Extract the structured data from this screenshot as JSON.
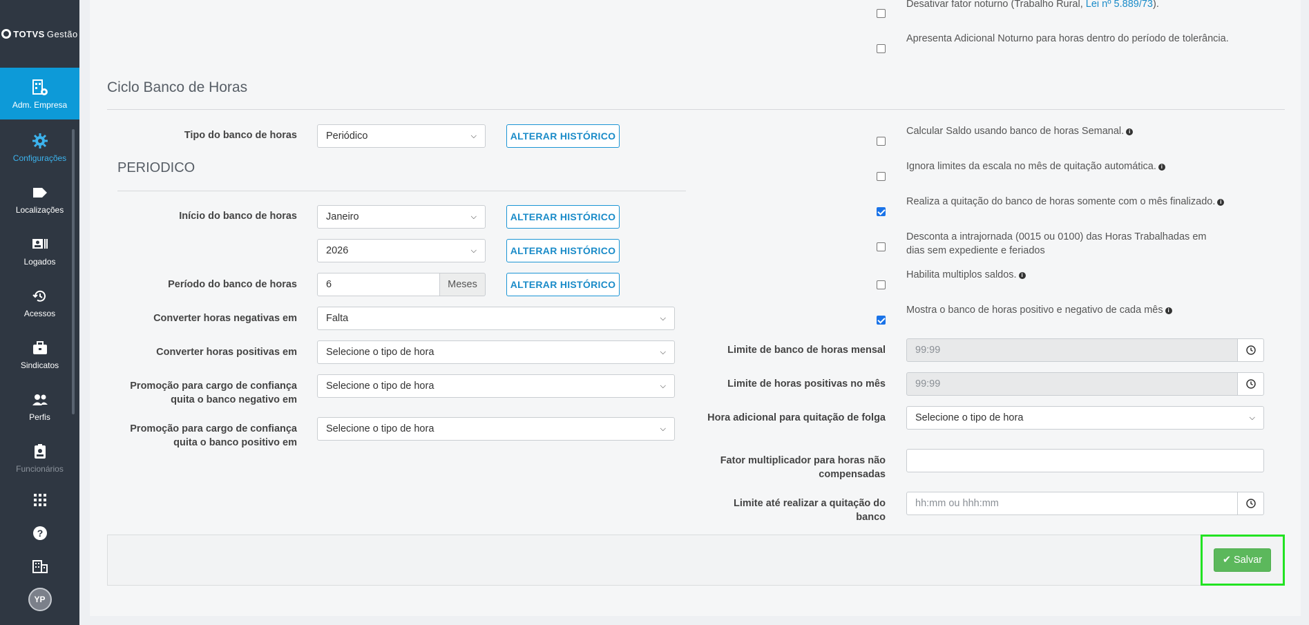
{
  "sidebar": {
    "logo_bold": "TOTVS",
    "logo_light": "Gestão",
    "items": [
      {
        "label": "Adm. Empresa",
        "icon": "building-cog-icon"
      },
      {
        "label": "Configurações",
        "icon": "gear-icon"
      },
      {
        "label": "Localizações",
        "icon": "tag-icon"
      },
      {
        "label": "Logados",
        "icon": "id-card-icon"
      },
      {
        "label": "Acessos",
        "icon": "history-icon"
      },
      {
        "label": "Sindicatos",
        "icon": "briefcase-icon"
      },
      {
        "label": "Perfis",
        "icon": "users-icon"
      },
      {
        "label": "Funcionários",
        "icon": "badge-icon"
      }
    ],
    "avatar_initials": "YP"
  },
  "top_checks": [
    {
      "text": "Desativar fator noturno (Trabalho Rural, ",
      "link": "Lei nº 5.889/73",
      "suffix": ").",
      "checked": false
    },
    {
      "text": "Apresenta Adicional Noturno para horas dentro do período de tolerância.",
      "checked": false
    }
  ],
  "ciclo": {
    "title": "Ciclo Banco de Horas",
    "tipo_label": "Tipo do banco de horas",
    "tipo_value": "Periódico",
    "alterar_label": "ALTERAR HISTÓRICO",
    "periodico_title": "PERIODICO",
    "inicio_label": "Início do banco de horas",
    "inicio_mes": "Janeiro",
    "inicio_ano": "2026",
    "periodo_label": "Período do banco de horas",
    "periodo_value": "6",
    "periodo_unit": "Meses",
    "neg_label": "Converter horas negativas em",
    "neg_value": "Falta",
    "pos_label": "Converter horas positivas em",
    "pos_value": "Selecione o tipo de hora",
    "promo_neg_label": "Promoção para cargo de confiança quita o banco negativo em",
    "promo_neg_value": "Selecione o tipo de hora",
    "promo_pos_label": "Promoção para cargo de confiança quita o banco positivo em",
    "promo_pos_value": "Selecione o tipo de hora"
  },
  "right_checks": [
    {
      "text": "Calcular Saldo usando banco de horas Semanal.",
      "checked": false,
      "info": true
    },
    {
      "text": "Ignora limites da escala no mês de quitação automática.",
      "checked": false,
      "info": true
    },
    {
      "text": "Realiza a quitação do banco de horas somente com o mês finalizado.",
      "checked": true,
      "info": true
    },
    {
      "text": "Desconta a intrajornada (0015 ou 0100) das Horas Trabalhadas em dias sem expediente e feriados",
      "checked": false,
      "info": false
    },
    {
      "text": "Habilita multiplos saldos.",
      "checked": false,
      "info": true
    },
    {
      "text": "Mostra o banco de horas positivo e negativo de cada mês",
      "checked": true,
      "info": true
    }
  ],
  "right_fields": {
    "limite_mensal_label": "Limite de banco de horas mensal",
    "limite_mensal_value": "99:99",
    "limite_pos_label": "Limite de horas positivas no mês",
    "limite_pos_value": "99:99",
    "hora_folga_label": "Hora adicional para quitação de folga",
    "hora_folga_value": "Selecione o tipo de hora",
    "fator_label": "Fator multiplicador para horas não compensadas",
    "fator_value": "",
    "limite_quit_label": "Limite até realizar a quitação do banco",
    "limite_quit_placeholder": "hh:mm ou hhh:mm"
  },
  "footer": {
    "save_label": "Salvar"
  }
}
